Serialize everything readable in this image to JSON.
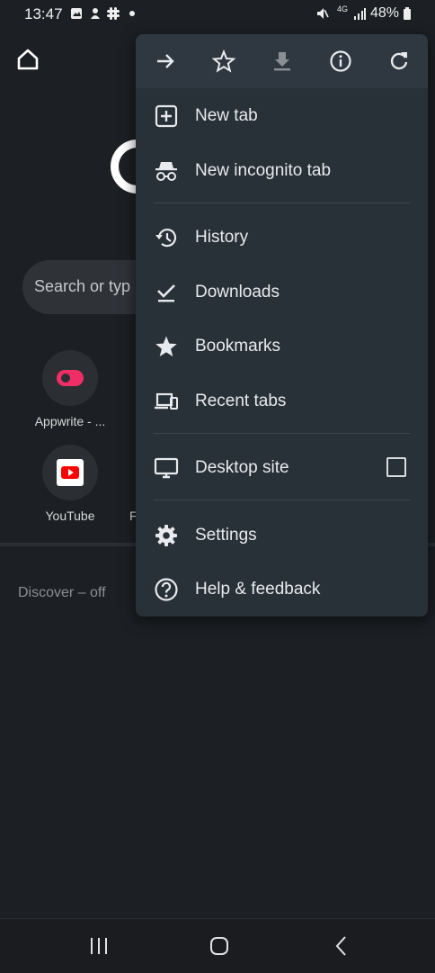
{
  "status_bar": {
    "time": "13:47",
    "network": "4G",
    "battery": "48%"
  },
  "ntp": {
    "search_placeholder": "Search or typ",
    "tiles": [
      {
        "label": "Appwrite - ..."
      },
      {
        "label": "YouTube"
      }
    ],
    "partial_tile_label": "F",
    "discover_label": "Discover – off"
  },
  "menu": {
    "items": [
      {
        "label": "New tab"
      },
      {
        "label": "New incognito tab"
      },
      {
        "label": "History"
      },
      {
        "label": "Downloads"
      },
      {
        "label": "Bookmarks"
      },
      {
        "label": "Recent tabs"
      },
      {
        "label": "Desktop site",
        "checked": false
      },
      {
        "label": "Settings"
      },
      {
        "label": "Help & feedback"
      }
    ]
  },
  "colors": {
    "background": "#1c1f23",
    "menu_bg": "#283038",
    "youtube_red": "#ff0000",
    "appwrite_pink": "#f02e65"
  }
}
